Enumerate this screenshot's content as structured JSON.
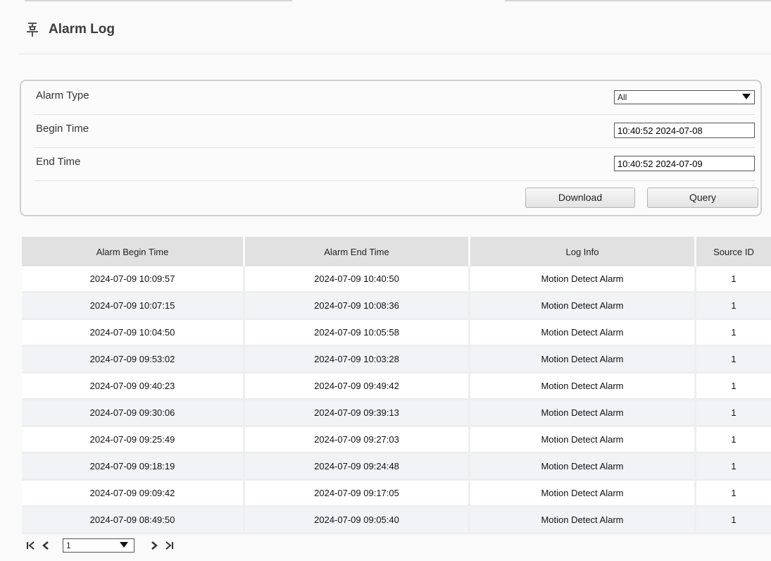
{
  "header": {
    "title": "Alarm Log",
    "icon": "alarm-log-icon"
  },
  "filters": {
    "alarm_type": {
      "label": "Alarm Type",
      "value": "All"
    },
    "begin_time": {
      "label": "Begin Time",
      "value": "10:40:52 2024-07-08"
    },
    "end_time": {
      "label": "End Time",
      "value": "10:40:52 2024-07-09"
    },
    "download_label": "Download",
    "query_label": "Query"
  },
  "table": {
    "columns": [
      "Alarm Begin Time",
      "Alarm End Time",
      "Log Info",
      "Source ID"
    ],
    "rows": [
      [
        "2024-07-09 10:09:57",
        "2024-07-09 10:40:50",
        "Motion Detect Alarm",
        "1"
      ],
      [
        "2024-07-09 10:07:15",
        "2024-07-09 10:08:36",
        "Motion Detect Alarm",
        "1"
      ],
      [
        "2024-07-09 10:04:50",
        "2024-07-09 10:05:58",
        "Motion Detect Alarm",
        "1"
      ],
      [
        "2024-07-09 09:53:02",
        "2024-07-09 10:03:28",
        "Motion Detect Alarm",
        "1"
      ],
      [
        "2024-07-09 09:40:23",
        "2024-07-09 09:49:42",
        "Motion Detect Alarm",
        "1"
      ],
      [
        "2024-07-09 09:30:06",
        "2024-07-09 09:39:13",
        "Motion Detect Alarm",
        "1"
      ],
      [
        "2024-07-09 09:25:49",
        "2024-07-09 09:27:03",
        "Motion Detect Alarm",
        "1"
      ],
      [
        "2024-07-09 09:18:19",
        "2024-07-09 09:24:48",
        "Motion Detect Alarm",
        "1"
      ],
      [
        "2024-07-09 09:09:42",
        "2024-07-09 09:17:05",
        "Motion Detect Alarm",
        "1"
      ],
      [
        "2024-07-09 08:49:50",
        "2024-07-09 09:05:40",
        "Motion Detect Alarm",
        "1"
      ]
    ]
  },
  "pager": {
    "page_value": "1"
  }
}
